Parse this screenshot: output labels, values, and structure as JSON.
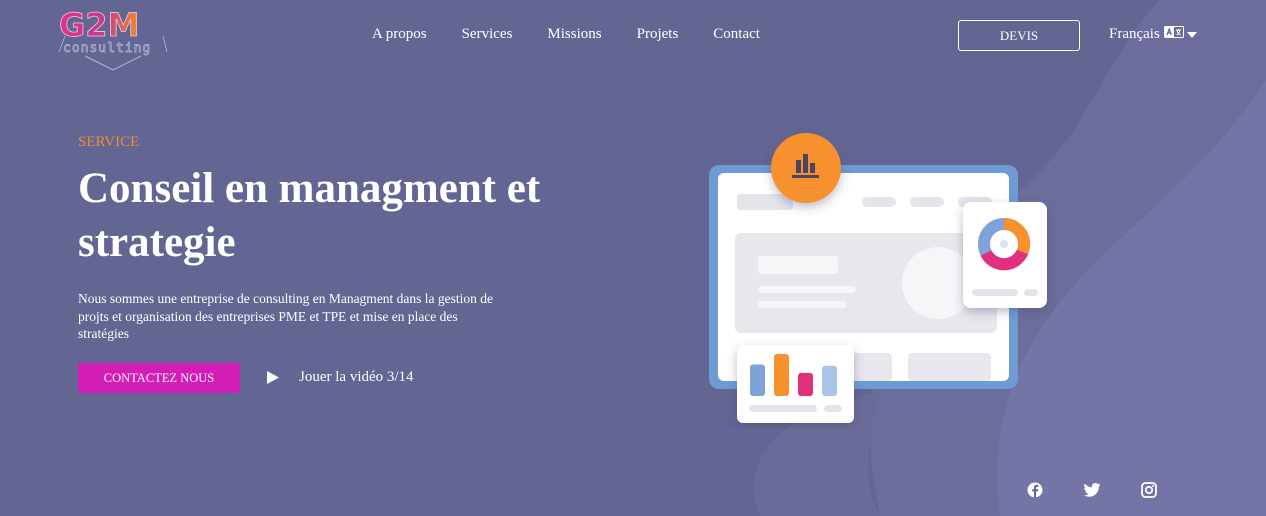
{
  "colors": {
    "background": "#636592",
    "accent_orange": "#f7912d",
    "accent_magenta": "#d21db6",
    "eyebrow": "#f08a3c"
  },
  "header": {
    "logo": {
      "text": "G2M",
      "sub": "consulting"
    },
    "nav": [
      "A propos",
      "Services",
      "Missions",
      "Projets",
      "Contact"
    ],
    "devis_label": "DEVIS",
    "language": "Français",
    "language_icon": "translate-icon",
    "caret_icon": "caret-down-icon"
  },
  "hero": {
    "eyebrow": "SERVICE",
    "title": "Conseil en managment et strategie",
    "description": "Nous sommes une entreprise de consulting en Managment dans la gestion de projts et organisation des entreprises PME et TPE et mise en place des stratégies",
    "cta_label": "CONTACTEZ NOUS",
    "video_label": "Jouer la vidéo 3/14",
    "video_icon": "play-icon"
  },
  "illustration": {
    "icons": [
      "bar-chart-icon",
      "donut-chart-icon"
    ],
    "bar_levels": [
      0.75,
      1.0,
      0.55,
      0.72
    ]
  },
  "socials": [
    "facebook-icon",
    "twitter-icon",
    "instagram-icon"
  ]
}
